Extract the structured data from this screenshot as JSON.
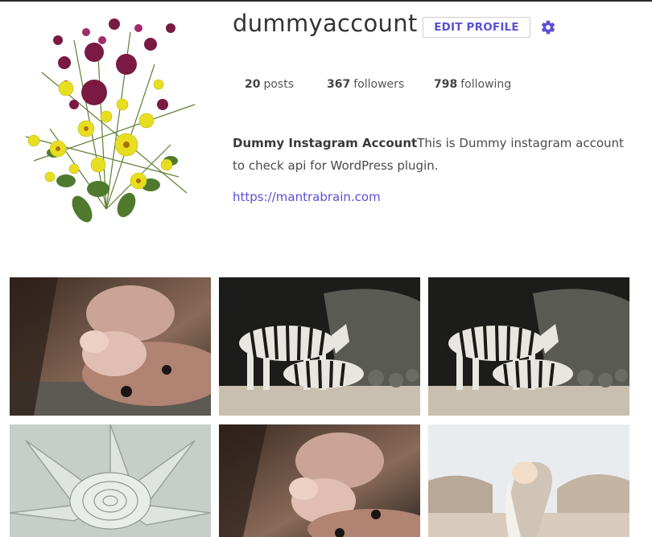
{
  "profile": {
    "username": "dummyaccount",
    "edit_label": "EDIT PROFILE",
    "posts_count": "20",
    "posts_label": "posts",
    "followers_count": "367",
    "followers_label": "followers",
    "following_count": "798",
    "following_label": "following",
    "bio_name": "Dummy Instagram Account",
    "bio_text": "This is Dummy instagram account to check api for WordPress plugin.",
    "website": "https://mantrabrain.com"
  },
  "colors": {
    "accent": "#5b4fd6",
    "text": "#444444"
  },
  "icons": {
    "settings": "gear-icon"
  },
  "posts": [
    {
      "subject": "baby-feet"
    },
    {
      "subject": "zebras"
    },
    {
      "subject": "zebras"
    },
    {
      "subject": "succulent"
    },
    {
      "subject": "baby-feet"
    },
    {
      "subject": "woman-desert"
    }
  ]
}
